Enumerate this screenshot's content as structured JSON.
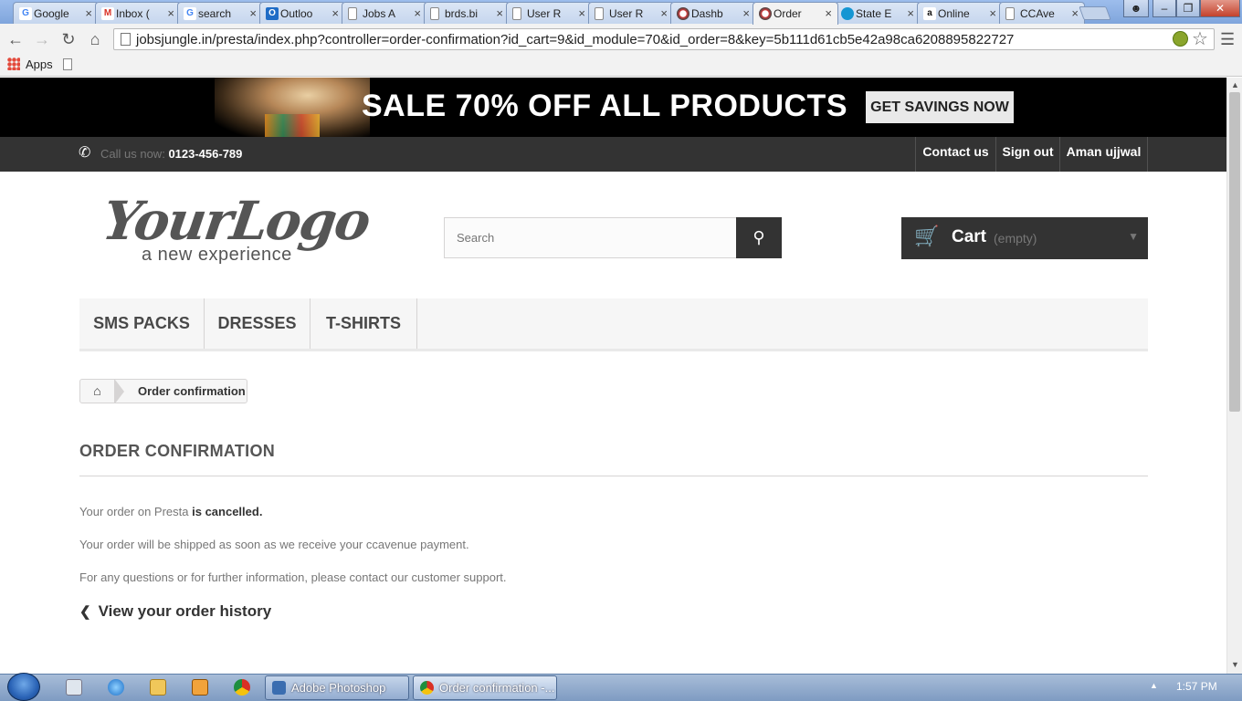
{
  "browser": {
    "tabs": [
      {
        "label": "Google",
        "icon": "google-icon",
        "color": "#ffffff"
      },
      {
        "label": "Inbox (",
        "icon": "gmail-icon",
        "color": "#ffffff"
      },
      {
        "label": "search",
        "icon": "google-icon",
        "color": "#ffffff"
      },
      {
        "label": "Outloo",
        "icon": "outlook-icon",
        "color": "#1f6cc6"
      },
      {
        "label": "Jobs A",
        "icon": "page-icon",
        "color": "#ffffff"
      },
      {
        "label": "brds.bi",
        "icon": "page-icon",
        "color": "#ffffff"
      },
      {
        "label": "User R",
        "icon": "page-icon",
        "color": "#ffffff"
      },
      {
        "label": "User R",
        "icon": "page-icon",
        "color": "#ffffff"
      },
      {
        "label": "Dashb",
        "icon": "prestashop-icon",
        "color": "#ffffff"
      },
      {
        "label": "Order",
        "icon": "prestashop-icon",
        "color": "#ffffff"
      },
      {
        "label": "State E",
        "icon": "sbi-icon",
        "color": "#1596d3"
      },
      {
        "label": "Online",
        "icon": "amazon-icon",
        "color": "#ffffff"
      },
      {
        "label": "CCAve",
        "icon": "page-icon",
        "color": "#ffffff"
      }
    ],
    "close_glyph": "×",
    "url": "jobsjungle.in/presta/index.php?controller=order-confirmation?id_cart=9&id_module=70&id_order=8&key=5b111d61cb5e42a98ca6208895822727",
    "bookmarks": {
      "apps_label": "Apps"
    }
  },
  "banner": {
    "sale_text": "SALE 70% OFF ALL PRODUCTS",
    "cta_label": "GET SAVINGS NOW"
  },
  "topnav": {
    "call_label": "Call us now:",
    "phone": "0123-456-789",
    "links": [
      "Contact us",
      "Sign out",
      "Aman ujjwal"
    ]
  },
  "header": {
    "logo_main": "YourLogo",
    "logo_tagline": "a new experience",
    "search_placeholder": "Search",
    "cart_label": "Cart",
    "cart_status": "(empty)"
  },
  "menu": [
    "SMS PACKS",
    "DRESSES",
    "T-SHIRTS"
  ],
  "breadcrumb": {
    "current": "Order confirmation"
  },
  "content": {
    "heading": "ORDER CONFIRMATION",
    "status_prefix": "Your order on Presta",
    "status_value": "is cancelled.",
    "shipping_note": "Your order will be shipped as soon as we receive your ccavenue payment.",
    "support_note": "For any questions or for further information, please contact our customer support.",
    "history_link": "View your order history"
  },
  "taskbar": {
    "buttons": [
      "Adobe Photoshop",
      "Order confirmation -..."
    ],
    "clock": "1:57 PM"
  }
}
